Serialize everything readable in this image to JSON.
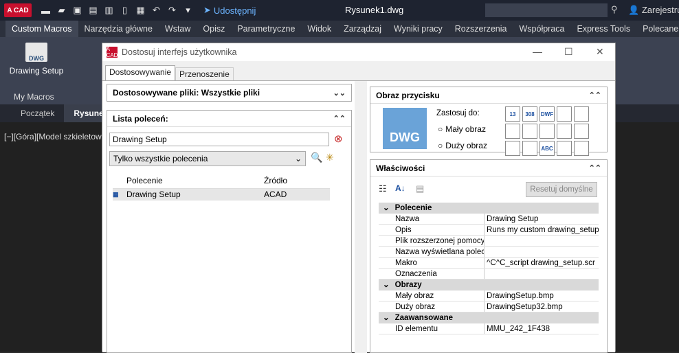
{
  "app": {
    "logo": "A CAD",
    "doc_title": "Rysunek1.dwg",
    "share_label": "Udostępnij",
    "user_label": "Zarejestruj"
  },
  "ribbon": {
    "tabs": [
      "Custom Macros",
      "Narzędzia główne",
      "Wstaw",
      "Opisz",
      "Parametryczne",
      "Widok",
      "Zarządzaj",
      "Wyniki pracy",
      "Rozszerzenia",
      "Współpraca",
      "Express Tools",
      "Polecane aplikacje"
    ],
    "button_label": "Drawing Setup",
    "button_icon_text": "DWG",
    "panel_name": "My Macros"
  },
  "file_tabs": [
    "Początek",
    "Rysunek"
  ],
  "viewport": {
    "label": "[−][Góra][Model szkieletow"
  },
  "dialog": {
    "title": "Dostosuj interfejs użytkownika",
    "logo": "A CAD",
    "tabs": [
      "Dostosowywanie",
      "Przenoszenie"
    ],
    "customized_files_label": "Dostosowywane pliki: Wszystkie pliki",
    "command_list_label": "Lista poleceń:",
    "search_value": "Drawing Setup",
    "filter_value": "Tylko wszystkie polecenia",
    "table": {
      "headers": [
        "Polecenie",
        "Źródło"
      ],
      "rows": [
        {
          "name": "Drawing Setup",
          "source": "ACAD"
        }
      ]
    },
    "button_image": {
      "label": "Obraz przycisku",
      "apply_to": "Zastosuj do:",
      "small": "Mały obraz",
      "large": "Duży obraz",
      "preview_text": "DWG"
    },
    "icon_labels": [
      "13",
      "308",
      "DWF",
      "",
      "",
      "",
      "",
      "",
      "",
      "",
      "",
      "",
      "ABC",
      "",
      ""
    ],
    "properties": {
      "label": "Właściwości",
      "reset_label": "Resetuj domyślne",
      "categories": [
        {
          "name": "Polecenie",
          "rows": [
            [
              "Nazwa",
              "Drawing Setup"
            ],
            [
              "Opis",
              "Runs my custom drawing_setup.scr"
            ],
            [
              "Plik rozszerzonej pomocy",
              ""
            ],
            [
              "Nazwa wyświetlana polecenia",
              ""
            ],
            [
              "Makro",
              "^C^C_script drawing_setup.scr"
            ],
            [
              "Oznaczenia",
              ""
            ]
          ]
        },
        {
          "name": "Obrazy",
          "rows": [
            [
              "Mały obraz",
              "DrawingSetup.bmp"
            ],
            [
              "Duży obraz",
              "DrawingSetup32.bmp"
            ]
          ]
        },
        {
          "name": "Zaawansowane",
          "rows": [
            [
              "ID elementu",
              "MMU_242_1F438"
            ]
          ]
        }
      ]
    }
  }
}
